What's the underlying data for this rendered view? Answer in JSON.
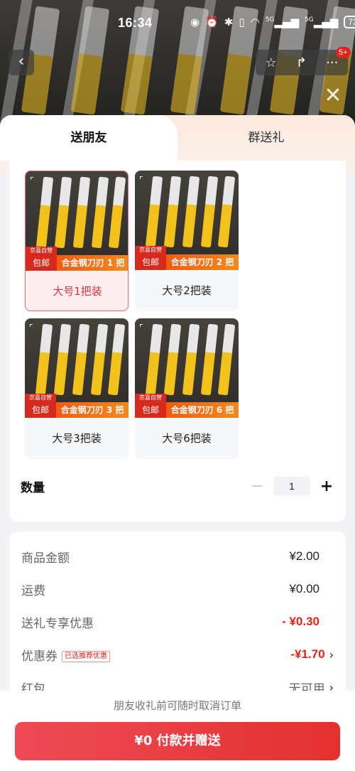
{
  "status_bar": {
    "time": "16:34",
    "icons": [
      "eye-icon",
      "alarm-icon",
      "bluetooth-icon",
      "vibrate-icon",
      "wifi-icon",
      "signal-5g-icon",
      "signal-5g-icon"
    ],
    "network_a": "5G",
    "network_b": "5G",
    "battery": "73"
  },
  "nav": {
    "back_symbol": "‹",
    "star_symbol": "☆",
    "share_symbol": "↱",
    "more_symbol": "···",
    "badge": "5+",
    "close_symbol": "✕"
  },
  "tabs": [
    {
      "label": "送朋友",
      "active": true
    },
    {
      "label": "群送礼",
      "active": false
    }
  ],
  "skus": [
    {
      "label": "大号1把装",
      "banner_left_top": "京喜自营",
      "banner_left": "包邮",
      "banner_right": "合金钢刀刃 1 把",
      "selected": true
    },
    {
      "label": "大号2把装",
      "banner_left_top": "京喜自营",
      "banner_left": "包邮",
      "banner_right": "合金钢刀刃 2 把",
      "selected": false
    },
    {
      "label": "大号3把装",
      "banner_left_top": "京喜自营",
      "banner_left": "包邮",
      "banner_right": "合金钢刀刃 3 把",
      "selected": false
    },
    {
      "label": "大号6把装",
      "banner_left_top": "京喜自营",
      "banner_left": "包邮",
      "banner_right": "合金钢刀刃 6 把",
      "selected": false
    }
  ],
  "quantity": {
    "title": "数量",
    "minus": "−",
    "value": "1",
    "plus": "+"
  },
  "price_rows": {
    "goods_label": "商品金额",
    "goods_value": "¥2.00",
    "shipping_label": "运费",
    "shipping_value": "¥0.00",
    "gift_discount_label": "送礼专享优惠",
    "gift_discount_value": "- ¥0.30",
    "coupon_label": "优惠券",
    "coupon_tag": "已选推荐优惠",
    "coupon_value": "-¥1.70",
    "redpacket_label": "红包",
    "redpacket_value": "无可用"
  },
  "bottom": {
    "note": "朋友收礼前可随时取消订单",
    "pay_button": "¥0 付款并赠送"
  },
  "colors": {
    "accent_red": "#e2231a",
    "button_gradient_start": "#ee4b57",
    "button_gradient_end": "#e3312f"
  }
}
